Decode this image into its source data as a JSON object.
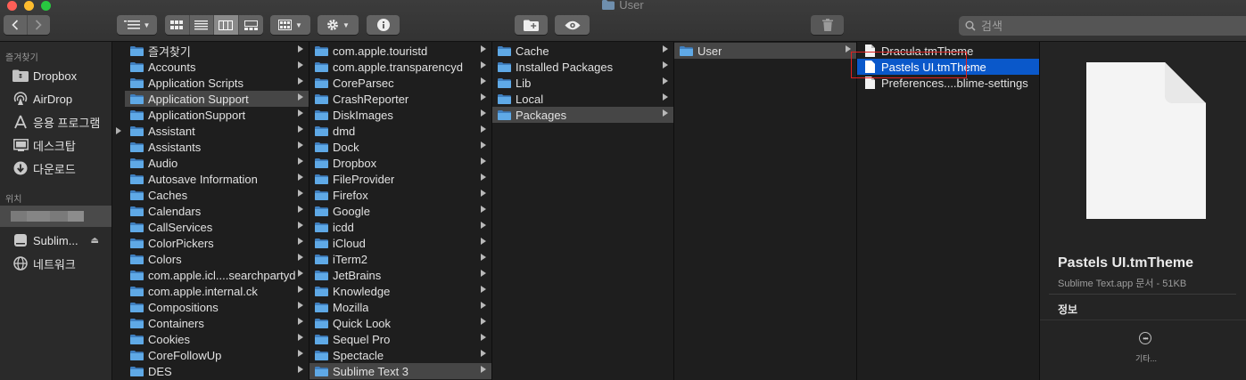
{
  "window": {
    "title": "User"
  },
  "toolbar": {
    "search_placeholder": "검색"
  },
  "sidebar": {
    "favorites_header": "즐겨찾기",
    "favorites": [
      {
        "label": "Dropbox",
        "icon": "dropbox-folder-icon"
      },
      {
        "label": "AirDrop",
        "icon": "airdrop-icon"
      },
      {
        "label": "응용 프로그램",
        "icon": "applications-icon"
      },
      {
        "label": "데스크탑",
        "icon": "desktop-icon"
      },
      {
        "label": "다운로드",
        "icon": "downloads-icon"
      }
    ],
    "locations_header": "위치",
    "locations": [
      {
        "label": "Sublim...",
        "icon": "disk-icon"
      },
      {
        "label": "네트워크",
        "icon": "network-icon"
      }
    ]
  },
  "columns": [
    {
      "items": [
        "즐겨찾기",
        "Accounts",
        "Application Scripts",
        "Application Support",
        "ApplicationSupport",
        "Assistant",
        "Assistants",
        "Audio",
        "Autosave Information",
        "Caches",
        "Calendars",
        "CallServices",
        "ColorPickers",
        "Colors",
        "com.apple.icl....searchpartyd",
        "com.apple.internal.ck",
        "Compositions",
        "Containers",
        "Cookies",
        "CoreFollowUp",
        "DES"
      ],
      "selected": 3
    },
    {
      "items": [
        "com.apple.touristd",
        "com.apple.transparencyd",
        "CoreParsec",
        "CrashReporter",
        "DiskImages",
        "dmd",
        "Dock",
        "Dropbox",
        "FileProvider",
        "Firefox",
        "Google",
        "icdd",
        "iCloud",
        "iTerm2",
        "JetBrains",
        "Knowledge",
        "Mozilla",
        "Quick Look",
        "Sequel Pro",
        "Spectacle",
        "Sublime Text 3"
      ],
      "selected": 20
    },
    {
      "items": [
        "Cache",
        "Installed Packages",
        "Lib",
        "Local",
        "Packages"
      ],
      "selected": 4
    },
    {
      "items": [
        "User"
      ],
      "selected": 0
    },
    {
      "items": [
        "Dracula.tmTheme",
        "Pastels UI.tmTheme",
        "Preferences....blime-settings"
      ],
      "selected": 1
    }
  ],
  "preview": {
    "filename": "Pastels UI.tmTheme",
    "subtitle": "Sublime Text.app 문서 - 51KB",
    "info_header": "정보",
    "more_label": "기타..."
  },
  "colors": {
    "folder": "#5fa9e6",
    "selection_blue": "#0a58ca",
    "selection_gray": "#464646",
    "highlight_box": "#e02020"
  }
}
